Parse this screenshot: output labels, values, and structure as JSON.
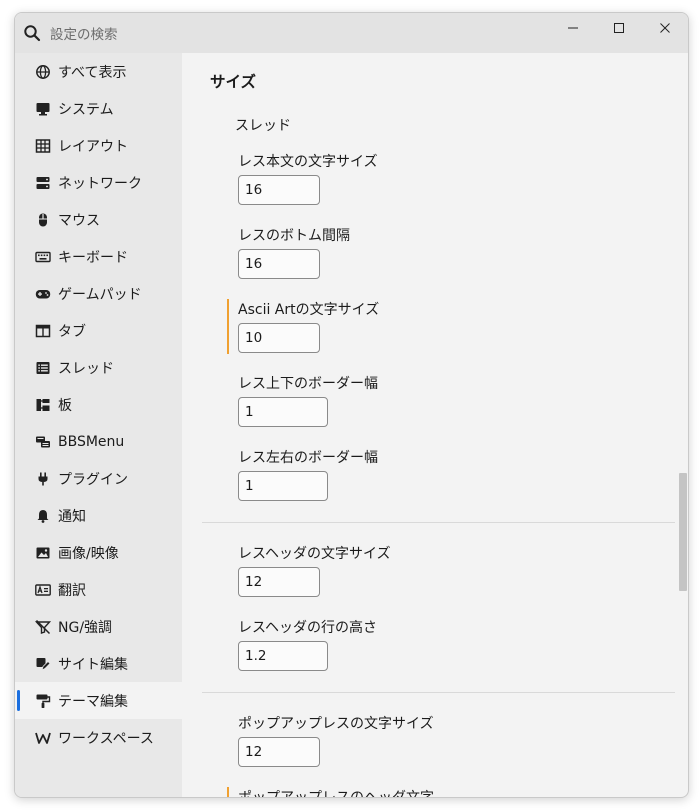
{
  "search": {
    "placeholder": "設定の検索"
  },
  "sidebar": {
    "items": [
      {
        "label": "すべて表示",
        "icon": "globe-icon"
      },
      {
        "label": "システム",
        "icon": "monitor-icon"
      },
      {
        "label": "レイアウト",
        "icon": "grid-icon"
      },
      {
        "label": "ネットワーク",
        "icon": "server-icon"
      },
      {
        "label": "マウス",
        "icon": "mouse-icon"
      },
      {
        "label": "キーボード",
        "icon": "keyboard-icon"
      },
      {
        "label": "ゲームパッド",
        "icon": "gamepad-icon"
      },
      {
        "label": "タブ",
        "icon": "tab-icon"
      },
      {
        "label": "スレッド",
        "icon": "list-icon"
      },
      {
        "label": "板",
        "icon": "board-tree-icon"
      },
      {
        "label": "BBSMenu",
        "icon": "bbsmenu-icon"
      },
      {
        "label": "プラグイン",
        "icon": "plug-icon"
      },
      {
        "label": "通知",
        "icon": "bell-icon"
      },
      {
        "label": "画像/映像",
        "icon": "image-icon"
      },
      {
        "label": "翻訳",
        "icon": "translate-icon"
      },
      {
        "label": "NG/強調",
        "icon": "ng-filter-icon"
      },
      {
        "label": "サイト編集",
        "icon": "site-edit-icon"
      },
      {
        "label": "テーマ編集",
        "icon": "paint-roller-icon"
      },
      {
        "label": "ワークスペース",
        "icon": "workspace-w-icon"
      }
    ],
    "active_index": 17
  },
  "main": {
    "section_title": "サイズ",
    "group_label": "スレッド",
    "fields": [
      {
        "label": "レス本文の文字サイズ",
        "value": "16"
      },
      {
        "label": "レスのボトム間隔",
        "value": "16"
      },
      {
        "label": "Ascii Artの文字サイズ",
        "value": "10",
        "modified": true
      },
      {
        "label": "レス上下のボーダー幅",
        "value": "1"
      },
      {
        "label": "レス左右のボーダー幅",
        "value": "1"
      },
      {
        "label": "レスヘッダの文字サイズ",
        "value": "12"
      },
      {
        "label": "レスヘッダの行の高さ",
        "value": "1.2"
      },
      {
        "label": "ポップアップレスの文字サイズ",
        "value": "12"
      },
      {
        "label": "ポップアップレスのヘッダ文字",
        "modified": true
      }
    ]
  },
  "colors": {
    "accent": "#1a6fe0",
    "modified_marker": "#f0a030",
    "sidebar_bg": "#e8e8e8",
    "content_bg": "#f3f3f3"
  }
}
